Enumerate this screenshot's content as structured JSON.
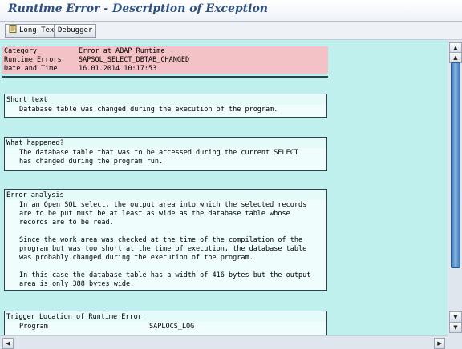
{
  "window": {
    "title": "Runtime Error - Description of Exception"
  },
  "toolbar": {
    "long_text_label": "Long Text",
    "debugger_label": "Debugger"
  },
  "header": {
    "rows": [
      {
        "key": "Category",
        "value": "Error at ABAP Runtime"
      },
      {
        "key": "Runtime Errors",
        "value": "SAPSQL_SELECT_DBTAB_CHANGED"
      },
      {
        "key": "Date and Time",
        "value": "16.01.2014 10:17:53"
      }
    ]
  },
  "sections": {
    "short_text": {
      "title": "Short text",
      "lines": [
        "Database table was changed during the execution of the program."
      ]
    },
    "what_happened": {
      "title": "What happened?",
      "lines": [
        "The database table that was to be accessed during the current SELECT",
        "has changed during the program run."
      ]
    },
    "error_analysis": {
      "title": "Error analysis",
      "lines": [
        "In an Open SQL select, the output area into which the selected records",
        "are to be put must be at least as wide as the database table whose",
        "records are to be read.",
        "",
        "Since the work area was checked at the time of the compilation of the",
        "program but was too short at the time of execution, the database table",
        "was probably changed during the execution of the program.",
        "",
        "In this case the database table has a width of 416 bytes but the output",
        "area is only 388 bytes wide."
      ]
    },
    "trigger_location": {
      "title": "Trigger Location of Runtime Error",
      "program_key": "Program",
      "program_value": "SAPLOCS_LOG"
    }
  },
  "icons": {
    "long_text": "document-icon",
    "scroll_up": "arrow-up-icon",
    "scroll_down": "arrow-down-icon",
    "scroll_left": "arrow-left-icon",
    "scroll_right": "arrow-right-icon"
  },
  "colors": {
    "background": "#bff0ee",
    "header_band": "#f3c2c6",
    "box_title_bg": "#e4fbfa",
    "box_body_bg": "#f0fdfd",
    "title_text": "#2d4f82",
    "scroll_thumb": "#3b76b5"
  }
}
